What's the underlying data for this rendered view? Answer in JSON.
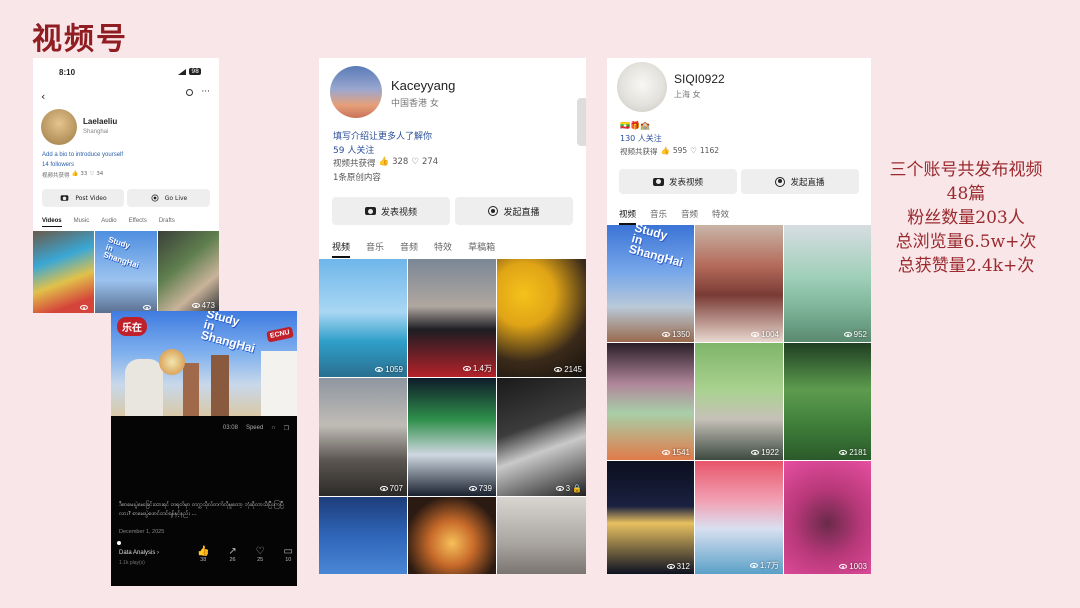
{
  "slide": {
    "title": "视频号",
    "summary": [
      "三个账号共发布视频",
      "48篇",
      "粉丝数量203人",
      "总浏览量6.5w+次",
      "总获赞量2.4k+次"
    ]
  },
  "p1": {
    "time": "8:10",
    "battery": "98",
    "name": "Laelaeliu",
    "location": "Shanghai",
    "bio": "Add a bio to introduce yourself",
    "followers": "14 followers",
    "likes_label": "视频共获得",
    "likes1": "33",
    "likes2": "34",
    "post_btn": "Post Video",
    "live_btn": "Go Live",
    "tabs": [
      "Videos",
      "Music",
      "Audio",
      "Effects",
      "Drafts"
    ],
    "tile_views": [
      "",
      "",
      "473"
    ],
    "sticker": [
      "Study",
      "in",
      "ShangHai"
    ]
  },
  "player": {
    "logo": "乐在",
    "ecnu": "ECNU",
    "sticker": [
      "Study",
      "in",
      "ShangHai"
    ],
    "duration": "03:08",
    "speed": "Speed",
    "caption": "ဒီစာမေးပွဲမေးခြင်းထားရင် တရုတ်မှာ တက္ကသိုလ်တက်လိုမှုတော့ ဘုံဆိုတာသိပြီးကြပြီလား? စာမေးပွဲဖောင်တင်ရန်နှင့်နည်း ...",
    "date": "December 1, 2025",
    "data_analysis": "Data Analysis",
    "plays": "1.1k play(s)",
    "likes": "38",
    "shares": "26",
    "favs": "25",
    "comments": "10"
  },
  "p2": {
    "name": "Kaceyyang",
    "location": "中国香港 女",
    "bio": "填写介绍让更多人了解你",
    "follows": "59 人关注",
    "likes_label": "视频共获得",
    "likes1": "328",
    "likes2": "274",
    "original": "1条原创内容",
    "post_btn": "发表视频",
    "live_btn": "发起直播",
    "tabs": [
      "视频",
      "音乐",
      "音频",
      "特效",
      "草稿箱"
    ],
    "tile_views": [
      "1059",
      "1.4万",
      "2145",
      "707",
      "739",
      "3",
      "",
      "",
      ""
    ]
  },
  "p3": {
    "name": "SIQI0922",
    "location": "上海 女",
    "follows": "130 人关注",
    "likes_label": "视频共获得",
    "likes1": "595",
    "likes2": "1162",
    "post_btn": "发表视频",
    "live_btn": "发起直播",
    "tabs": [
      "视频",
      "音乐",
      "音频",
      "特效"
    ],
    "tile_views": [
      "1350",
      "1004",
      "952",
      "1541",
      "1922",
      "2181",
      "312",
      "1.7万",
      "1003"
    ],
    "sticker": [
      "Study",
      "in",
      "ShangHai"
    ]
  }
}
